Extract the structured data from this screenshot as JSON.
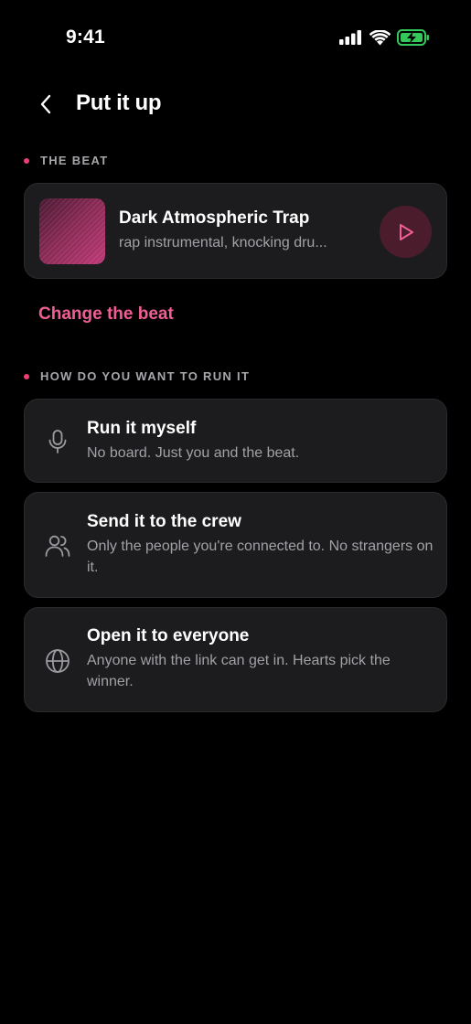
{
  "status": {
    "time": "9:41"
  },
  "nav": {
    "title": "Put it up"
  },
  "beat_section": {
    "label": "THE BEAT",
    "beat": {
      "title": "Dark Atmospheric Trap",
      "subtitle": "rap instrumental, knocking dru..."
    },
    "change_label": "Change the beat"
  },
  "run_section": {
    "label": "HOW DO YOU WANT TO RUN IT",
    "options": [
      {
        "title": "Run it myself",
        "description": "No board. Just you and the beat.",
        "icon": "microphone-icon"
      },
      {
        "title": "Send it to the crew",
        "description": "Only the people you're connected to. No strangers on it.",
        "icon": "users-icon"
      },
      {
        "title": "Open it to everyone",
        "description": "Anyone with the link can get in. Hearts pick the winner.",
        "icon": "globe-icon"
      }
    ]
  },
  "colors": {
    "accent": "#f05f93",
    "dot": "#ec3f73",
    "card": "#1c1c1e",
    "battery": "#34c759"
  }
}
